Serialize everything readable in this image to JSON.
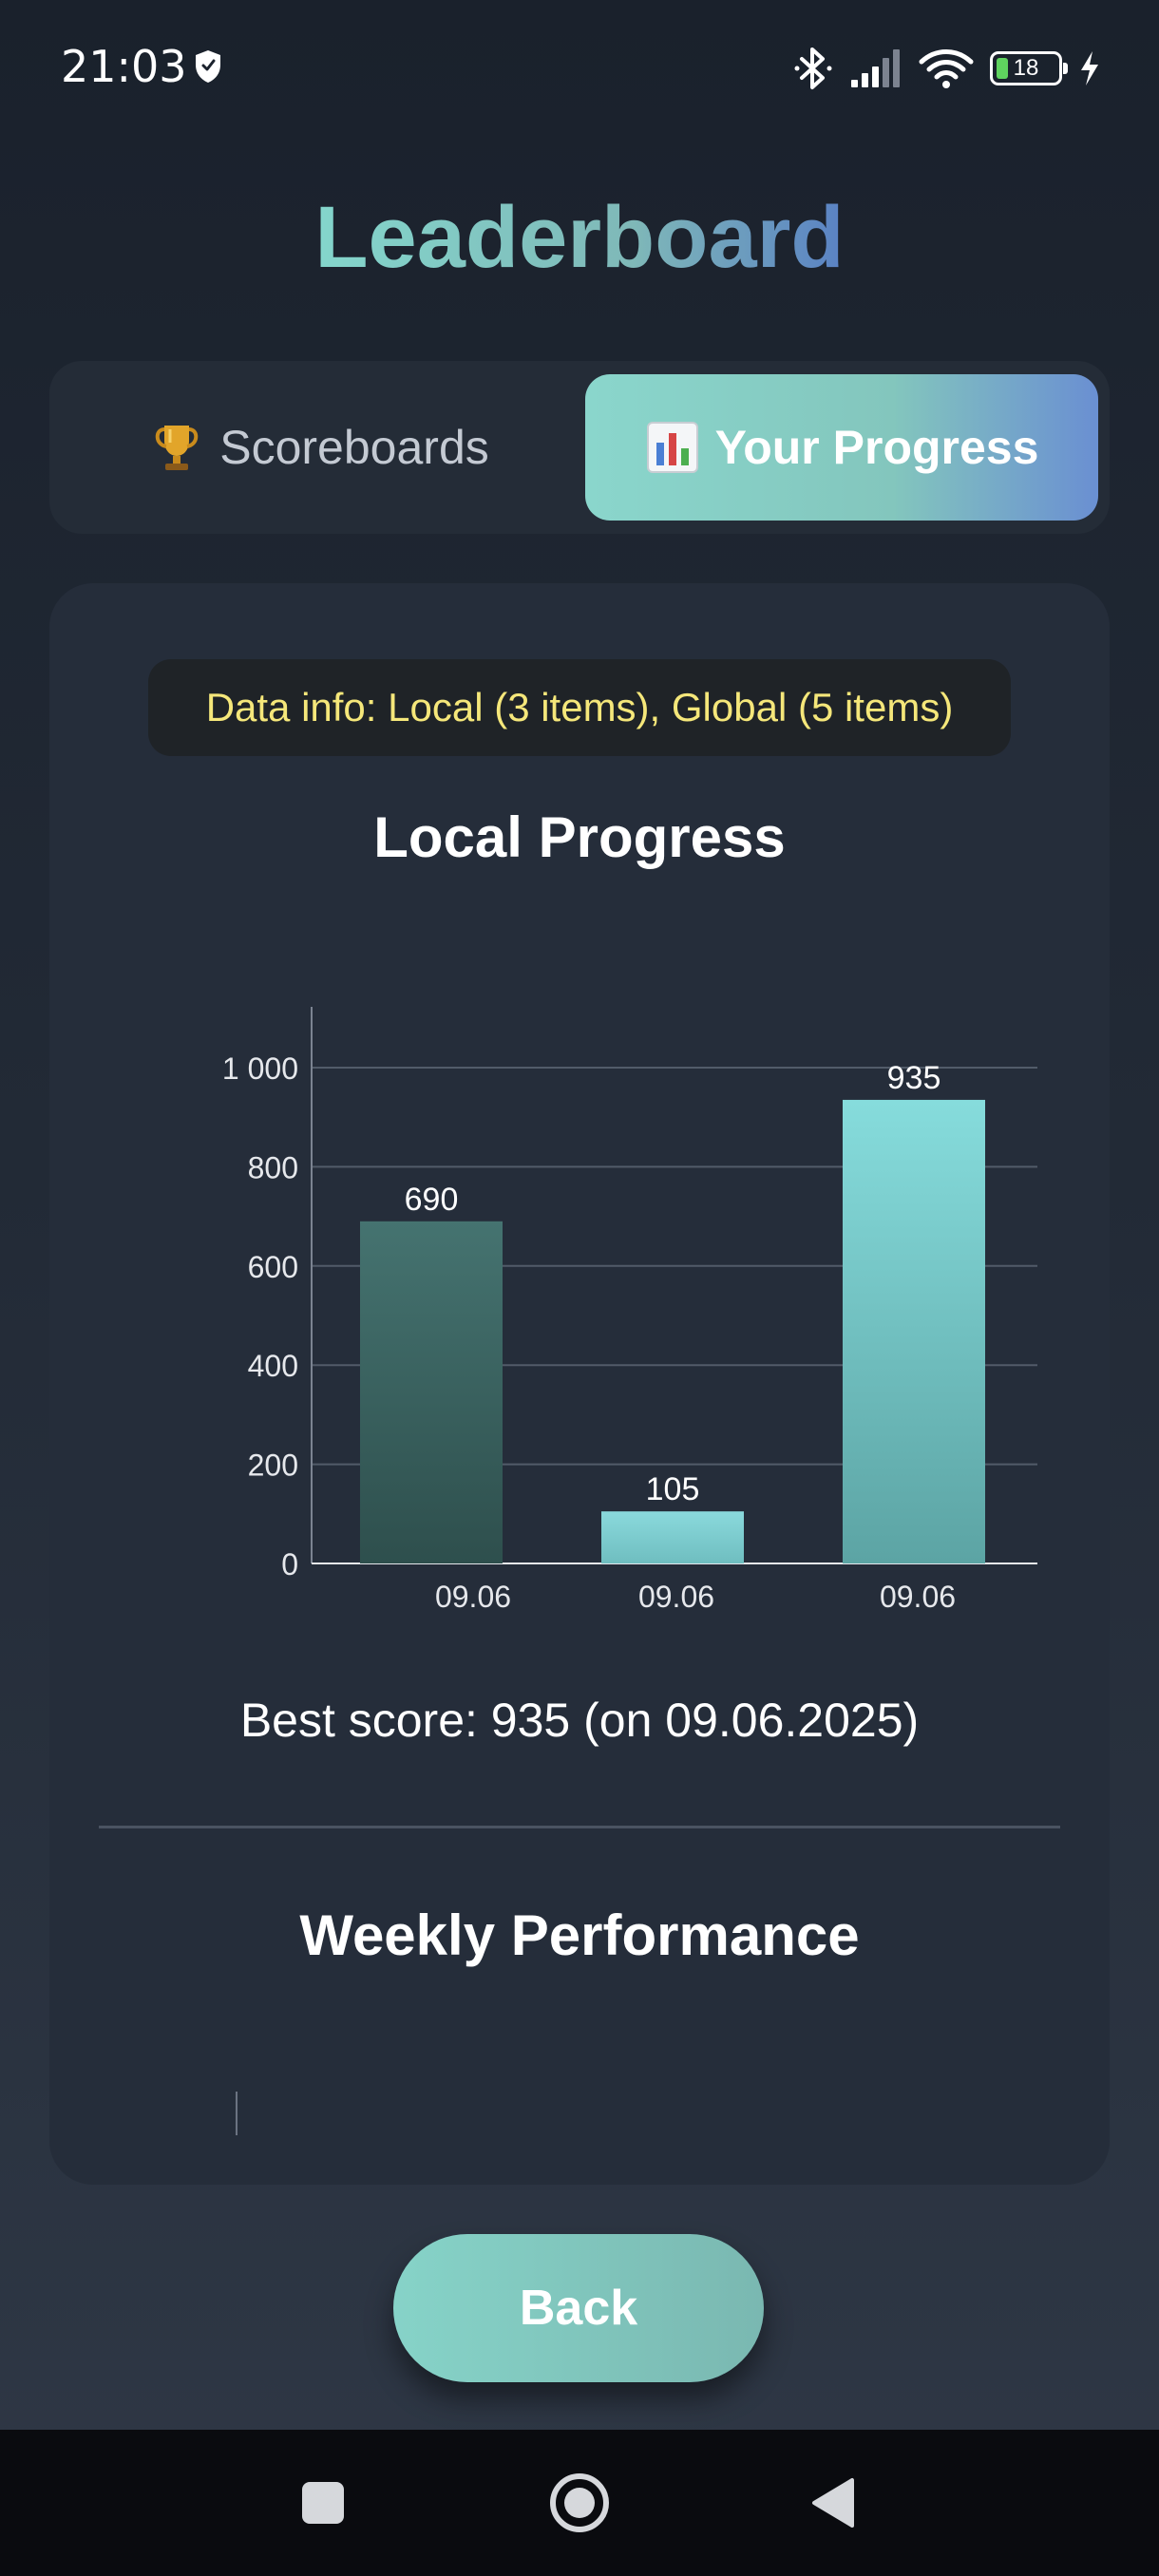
{
  "status_bar": {
    "time": "21:03",
    "battery_level": "18",
    "battery_fraction": 0.18
  },
  "header": {
    "title": "Leaderboard"
  },
  "tabs": [
    {
      "label": "Scoreboards",
      "icon": "trophy-icon",
      "active": false
    },
    {
      "label": "Your Progress",
      "icon": "bar-chart-icon",
      "active": true
    }
  ],
  "main": {
    "data_info": "Data info: Local (3 items), Global (5 items)",
    "local_title": "Local Progress",
    "best_score": "Best score: 935 (on 09.06.2025)",
    "weekly_title": "Weekly Performance",
    "back_label": "Back"
  },
  "chart_data": {
    "type": "bar",
    "categories": [
      "09.06",
      "09.06",
      "09.06"
    ],
    "values": [
      690,
      105,
      935
    ],
    "data_labels": [
      "690",
      "105",
      "935"
    ],
    "y_ticks": [
      0,
      200,
      400,
      600,
      800,
      1000
    ],
    "y_tick_labels": [
      "0",
      "200",
      "400",
      "600",
      "800",
      "1 000"
    ],
    "ylim": [
      0,
      1000
    ],
    "grid": true,
    "colors": [
      [
        "#457370",
        "#2e4f4d"
      ],
      [
        "#8ad9dc",
        "#6fbec0"
      ],
      [
        "#86dcdc",
        "#5ca4a4"
      ]
    ]
  },
  "colors": {
    "accent": "#84d6cc",
    "accent_blue": "#5a82c4",
    "info_text": "#f5e77a",
    "card_bg": "#252d3a"
  }
}
